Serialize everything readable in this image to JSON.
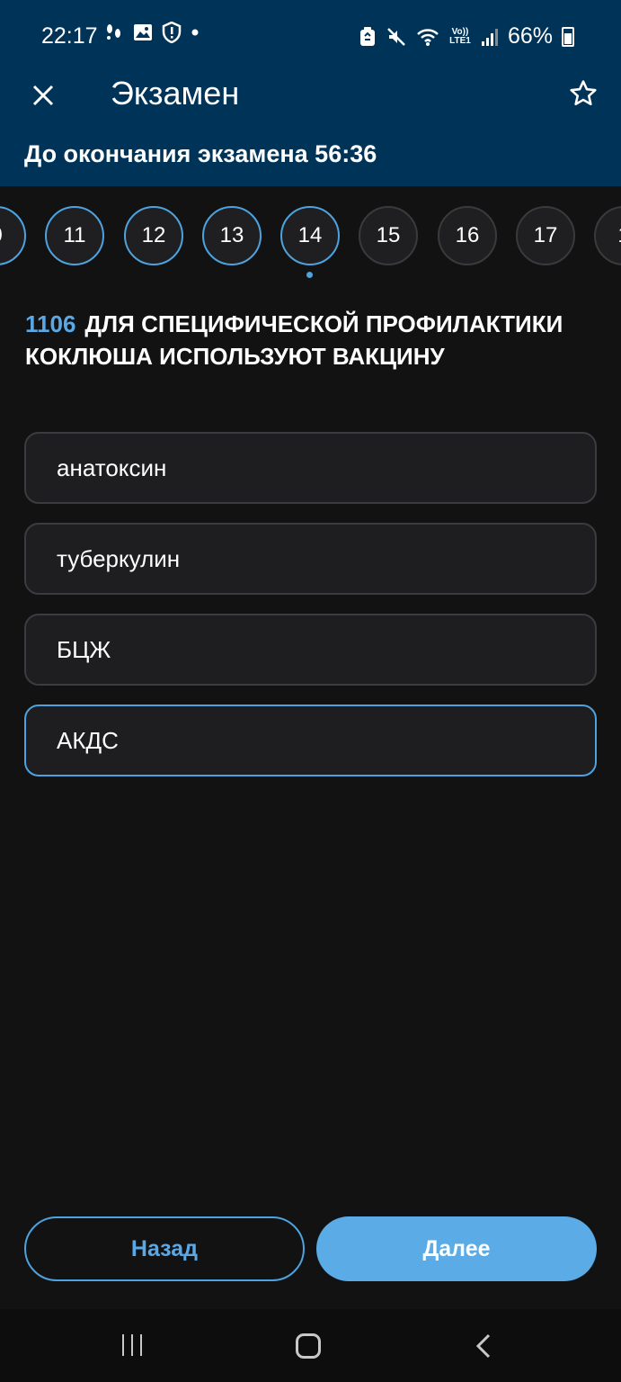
{
  "status_bar": {
    "time": "22:17",
    "left_icons": [
      "step-icon",
      "image-icon",
      "shield-icon",
      "dot-icon"
    ],
    "right_icons": [
      "recycle-icon",
      "mute-icon",
      "wifi-icon",
      "volte-icon",
      "signal-icon"
    ],
    "volte_label": "Vo)) LTE1",
    "battery": "66%"
  },
  "appbar": {
    "title": "Экзамен"
  },
  "timer": {
    "text": "До окончания экзамена 56:36"
  },
  "question_strip": {
    "items": [
      {
        "label": "0",
        "state": "answered"
      },
      {
        "label": "11",
        "state": "answered"
      },
      {
        "label": "12",
        "state": "answered"
      },
      {
        "label": "13",
        "state": "answered"
      },
      {
        "label": "14",
        "state": "current"
      },
      {
        "label": "15",
        "state": "unanswered"
      },
      {
        "label": "16",
        "state": "unanswered"
      },
      {
        "label": "17",
        "state": "unanswered"
      },
      {
        "label": "1",
        "state": "unanswered"
      }
    ]
  },
  "question": {
    "number": "1106",
    "text": "ДЛЯ СПЕЦИФИЧЕСКОЙ ПРОФИЛАКТИКИ КОКЛЮША ИСПОЛЬЗУЮТ ВАКЦИНУ"
  },
  "options": [
    {
      "label": "анатоксин",
      "selected": false
    },
    {
      "label": "туберкулин",
      "selected": false
    },
    {
      "label": "БЦЖ",
      "selected": false
    },
    {
      "label": "АКДС",
      "selected": true
    }
  ],
  "buttons": {
    "back_label": "Назад",
    "next_label": "Далее"
  },
  "colors": {
    "header_bg": "#003358",
    "accent": "#4da3df",
    "background": "#121212"
  }
}
